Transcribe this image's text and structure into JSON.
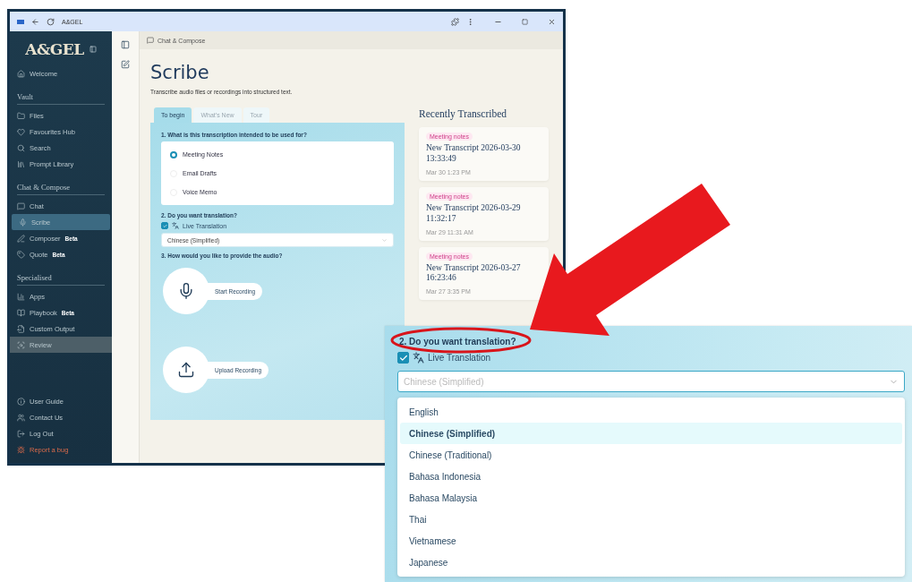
{
  "window": {
    "title": "A&GEL"
  },
  "sidebar": {
    "logo": "A&GEL",
    "top_items": [
      {
        "label": "Welcome",
        "selected": false,
        "hovered": false
      }
    ],
    "sections": [
      {
        "title": "Vault",
        "items": [
          {
            "label": "Files",
            "selected": false,
            "hovered": false
          },
          {
            "label": "Favourites Hub",
            "selected": false,
            "hovered": false
          },
          {
            "label": "Search",
            "selected": false,
            "hovered": false
          },
          {
            "label": "Prompt Library",
            "selected": false,
            "hovered": false
          }
        ]
      },
      {
        "title": "Chat & Compose",
        "items": [
          {
            "label": "Chat",
            "selected": false,
            "hovered": false
          },
          {
            "label": "Scribe",
            "selected": true,
            "hovered": false
          },
          {
            "label": "Composer",
            "badge": "Beta",
            "selected": false,
            "hovered": false
          },
          {
            "label": "Quote",
            "badge": "Beta",
            "selected": false,
            "hovered": false
          }
        ]
      },
      {
        "title": "Specialised",
        "items": [
          {
            "label": "Apps",
            "selected": false,
            "hovered": false
          },
          {
            "label": "Playbook",
            "badge": "Beta",
            "selected": false,
            "hovered": false
          },
          {
            "label": "Custom Output",
            "selected": false,
            "hovered": false
          },
          {
            "label": "Review",
            "selected": false,
            "hovered": true
          }
        ]
      }
    ],
    "footer_items": [
      {
        "label": "User Guide",
        "kind": "normal"
      },
      {
        "label": "Contact Us",
        "kind": "normal"
      },
      {
        "label": "Log Out",
        "kind": "normal"
      },
      {
        "label": "Report a bug",
        "kind": "alert"
      }
    ]
  },
  "breadcrumb": "Chat & Compose",
  "page": {
    "title": "Scribe",
    "subtitle": "Transcribe audio files or recordings into structured text."
  },
  "tabs": [
    {
      "label": "To begin",
      "selected": true
    },
    {
      "label": "What's New",
      "selected": false
    },
    {
      "label": "Tour",
      "selected": false
    }
  ],
  "form": {
    "q1": "1. What is this transcription intended to be used for?",
    "purposes": [
      {
        "label": "Meeting Notes",
        "selected": true
      },
      {
        "label": "Email Drafts",
        "selected": false
      },
      {
        "label": "Voice Memo",
        "selected": false
      }
    ],
    "q2": "2. Do you want translation?",
    "translation": {
      "label": "Live Translation",
      "checked": true
    },
    "language": {
      "value": "Chinese (Simplified)"
    },
    "q3": "3. How would you like to provide the audio?",
    "sources": [
      {
        "kind": "record",
        "label": "Start Recording"
      },
      {
        "kind": "upload",
        "label": "Upload Recording"
      }
    ]
  },
  "recent": {
    "title": "Recently Transcribed",
    "cards": [
      {
        "tag": "Meeting notes",
        "title": "New Transcript 2026-03-30 13:33:49",
        "date": "Mar 30 1:23 PM"
      },
      {
        "tag": "Meeting notes",
        "title": "New Transcript 2026-03-29 11:32:17",
        "date": "Mar 29 11:31 AM"
      },
      {
        "tag": "Meeting notes",
        "title": "New Transcript 2026-03-27 16:23:46",
        "date": "Mar 27 3:35 PM"
      }
    ]
  },
  "zoom_inset": {
    "question": "2. Do you want translation?",
    "translation": {
      "label": "Live Translation",
      "checked": true
    },
    "language": {
      "placeholder": "Chinese (Simplified)"
    },
    "options": [
      {
        "label": "English",
        "selected": false
      },
      {
        "label": "Chinese (Simplified)",
        "selected": true
      },
      {
        "label": "Chinese (Traditional)",
        "selected": false
      },
      {
        "label": "Bahasa Indonesia",
        "selected": false
      },
      {
        "label": "Bahasa Malaysia",
        "selected": false
      },
      {
        "label": "Thai",
        "selected": false
      },
      {
        "label": "Vietnamese",
        "selected": false
      },
      {
        "label": "Japanese",
        "selected": false
      }
    ]
  }
}
